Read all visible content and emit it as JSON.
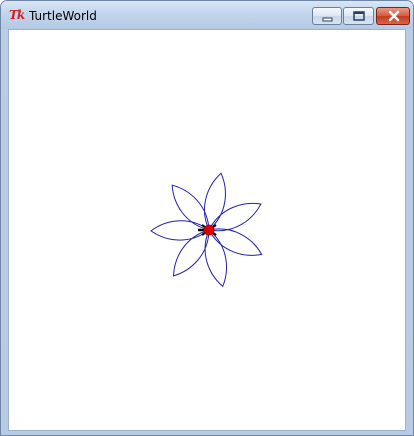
{
  "window": {
    "title": "TurtleWorld",
    "app_icon_text": "Tk"
  },
  "drawing": {
    "petal_count": 7,
    "petal_color": "#2222aa",
    "turtle_color": "#dd0000",
    "turtle_outline_color": "#000000"
  }
}
